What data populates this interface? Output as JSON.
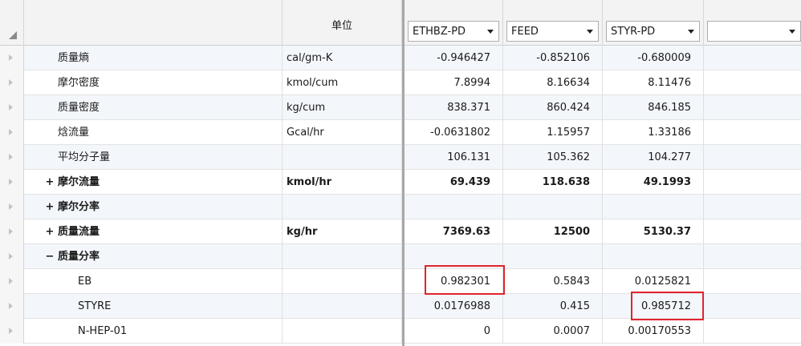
{
  "header": {
    "unit_label": "单位",
    "streams": [
      {
        "label": "ETHBZ-PD"
      },
      {
        "label": "FEED"
      },
      {
        "label": "STYR-PD"
      },
      {
        "label": ""
      }
    ]
  },
  "rows": [
    {
      "name": "质量熵",
      "unit": "cal/gm-K",
      "v": [
        "-0.946427",
        "-0.852106",
        "-0.680009",
        ""
      ]
    },
    {
      "name": "摩尔密度",
      "unit": "kmol/cum",
      "v": [
        "7.8994",
        "8.16634",
        "8.11476",
        ""
      ]
    },
    {
      "name": "质量密度",
      "unit": "kg/cum",
      "v": [
        "838.371",
        "860.424",
        "846.185",
        ""
      ]
    },
    {
      "name": "焓流量",
      "unit": "Gcal/hr",
      "v": [
        "-0.0631802",
        "1.15957",
        "1.33186",
        ""
      ]
    },
    {
      "name": "平均分子量",
      "unit": "",
      "v": [
        "106.131",
        "105.362",
        "104.277",
        ""
      ]
    },
    {
      "name": "摩尔流量",
      "expander": "+",
      "unit": "kmol/hr",
      "v": [
        "69.439",
        "118.638",
        "49.1993",
        ""
      ]
    },
    {
      "name": "摩尔分率",
      "expander": "+",
      "unit": "",
      "v": [
        "",
        "",
        "",
        ""
      ]
    },
    {
      "name": "质量流量",
      "expander": "+",
      "unit": "kg/hr",
      "v": [
        "7369.63",
        "12500",
        "5130.37",
        ""
      ]
    },
    {
      "name": "质量分率",
      "expander": "−",
      "unit": "",
      "v": [
        "",
        "",
        "",
        ""
      ]
    },
    {
      "name": "EB",
      "unit": "",
      "v": [
        "0.982301",
        "0.5843",
        "0.0125821",
        ""
      ]
    },
    {
      "name": "STYRE",
      "unit": "",
      "v": [
        "0.0176988",
        "0.415",
        "0.985712",
        ""
      ]
    },
    {
      "name": "N-HEP-01",
      "unit": "",
      "v": [
        "0",
        "0.0007",
        "0.00170553",
        ""
      ]
    }
  ],
  "highlight_color": "#e0242f"
}
